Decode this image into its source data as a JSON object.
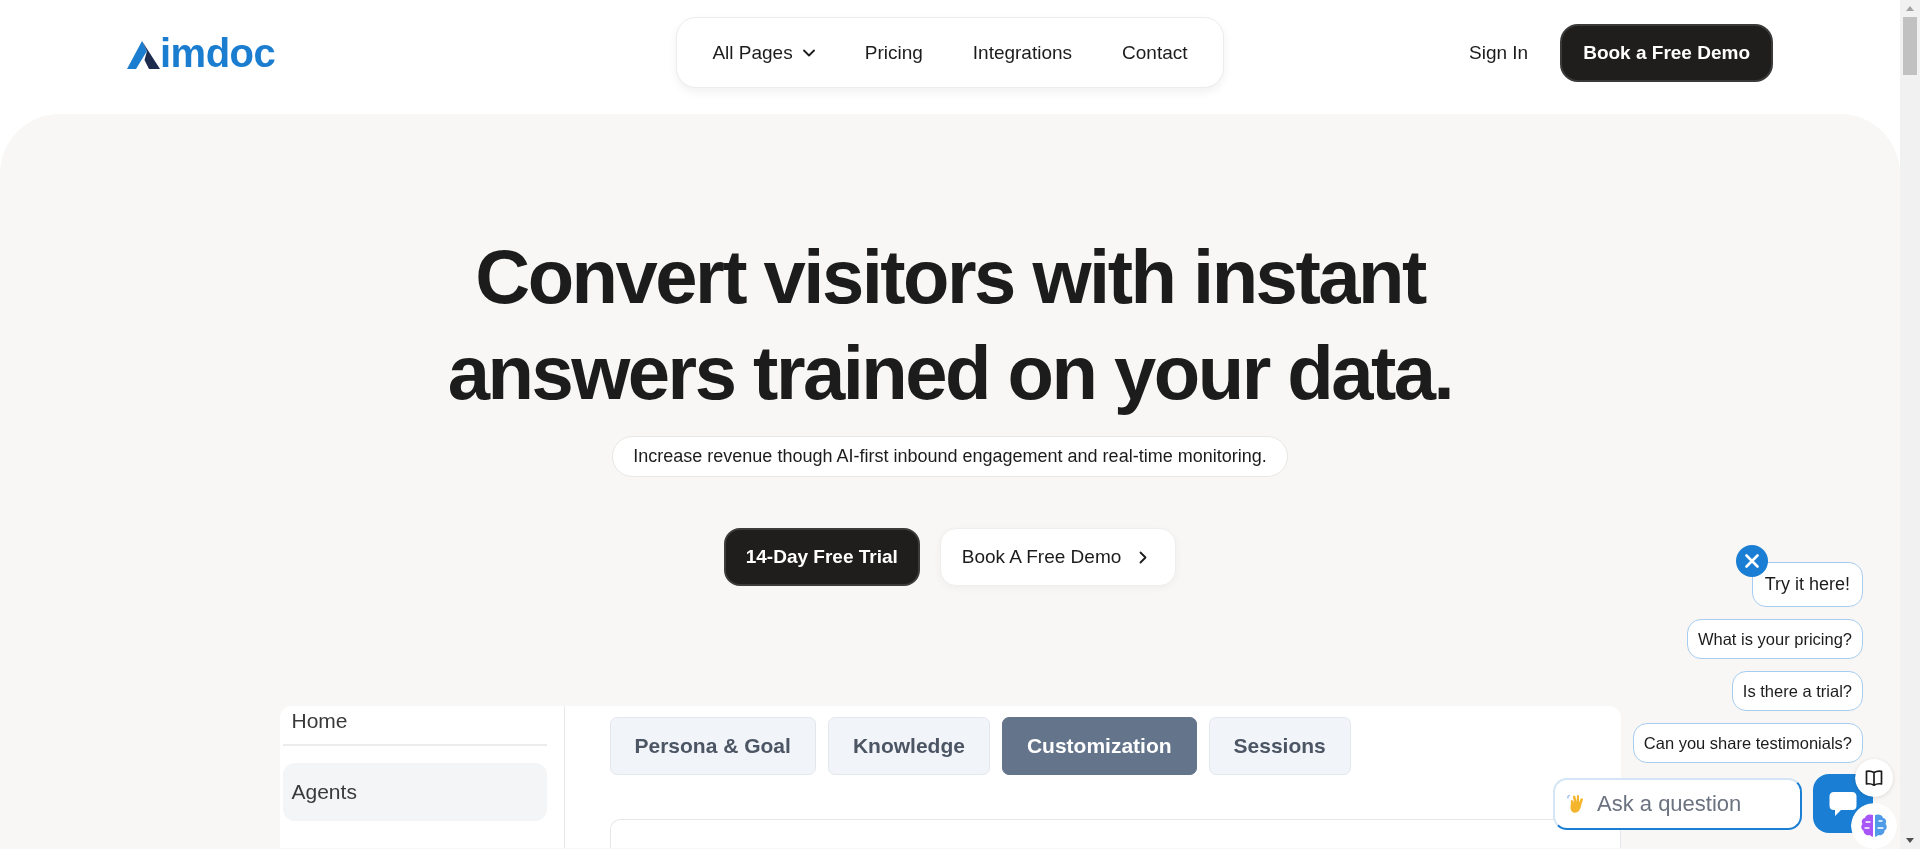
{
  "header": {
    "logo": "imdoc",
    "nav": [
      {
        "label": "All Pages",
        "kind": "dropdown"
      },
      {
        "label": "Pricing",
        "kind": "link"
      },
      {
        "label": "Integrations",
        "kind": "link"
      },
      {
        "label": "Contact",
        "kind": "link"
      }
    ],
    "sign_in": "Sign In",
    "cta": "Book a Free Demo"
  },
  "hero": {
    "headline": "Convert visitors with instant answers trained on your data.",
    "subtitle": "Increase revenue though AI-first inbound engagement and real-time monitoring.",
    "buttons": [
      {
        "label": "14-Day Free Trial",
        "kind": "primary"
      },
      {
        "label": "Book A Free Demo",
        "kind": "secondary"
      }
    ]
  },
  "app_preview": {
    "sidebar": [
      {
        "label": "Home",
        "selected": false
      },
      {
        "label": "Agents",
        "selected": true
      }
    ],
    "tabs": [
      {
        "label": "Persona & Goal",
        "selected": false
      },
      {
        "label": "Knowledge",
        "selected": false
      },
      {
        "label": "Customization",
        "selected": true
      },
      {
        "label": "Sessions",
        "selected": false
      }
    ]
  },
  "chat_widget": {
    "messages": [
      {
        "text": "Try it here!",
        "kind": "greeting"
      },
      {
        "text": "What is your pricing?",
        "kind": "question"
      },
      {
        "text": "Is there a trial?",
        "kind": "question"
      },
      {
        "text": "Can you share testimonials?",
        "kind": "question"
      }
    ],
    "input": {
      "placeholder": "Ask a question"
    }
  }
}
